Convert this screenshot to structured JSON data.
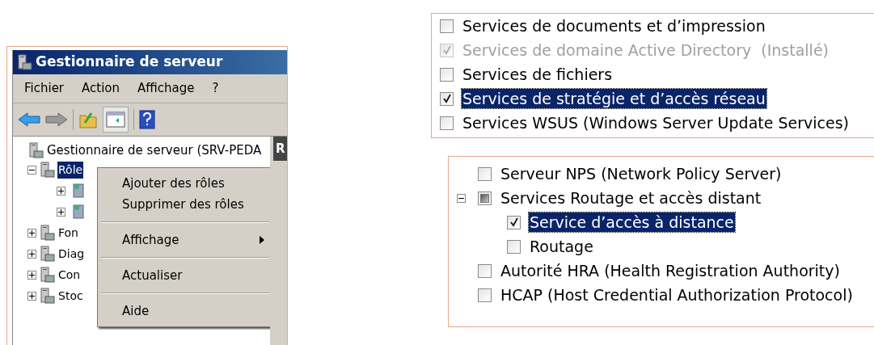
{
  "window": {
    "title": "Gestionnaire de serveur"
  },
  "menu_bar": [
    "Fichier",
    "Action",
    "Affichage",
    "?"
  ],
  "tree": {
    "label": "Gestionnaire de serveur (SRV-PEDA",
    "children": [
      {
        "label": "Rôle",
        "selected": true,
        "expanded": true,
        "children": [
          {
            "expanded": false
          },
          {
            "expanded": false
          }
        ]
      },
      {
        "label": "Fon",
        "selected": false,
        "expanded": false
      },
      {
        "label": "Diag",
        "selected": false,
        "expanded": false
      },
      {
        "label": "Con",
        "selected": false,
        "expanded": false
      },
      {
        "label": "Stoc",
        "selected": false,
        "expanded": false
      }
    ]
  },
  "right_pane_header": "R",
  "context_menu": [
    {
      "kind": "item",
      "label": "Ajouter des rôles"
    },
    {
      "kind": "item",
      "label": "Supprimer des rôles"
    },
    {
      "kind": "separator"
    },
    {
      "kind": "submenu",
      "label": "Affichage"
    },
    {
      "kind": "separator"
    },
    {
      "kind": "item",
      "label": "Actualiser"
    },
    {
      "kind": "separator"
    },
    {
      "kind": "item",
      "label": "Aide"
    }
  ],
  "roles_list": [
    {
      "label": "Services de documents et d’impression",
      "checked": false,
      "disabled": false,
      "selected": false
    },
    {
      "label": "Services de domaine Active Directory  (Installé)",
      "checked": true,
      "disabled": true,
      "selected": false
    },
    {
      "label": "Services de fichiers",
      "checked": false,
      "disabled": false,
      "selected": false
    },
    {
      "label": "Services de stratégie et d’accès réseau",
      "checked": true,
      "disabled": false,
      "selected": true
    },
    {
      "label": "Services WSUS (Windows Server Update Services)",
      "checked": false,
      "disabled": false,
      "selected": false
    }
  ],
  "role_services": [
    {
      "label": "Serveur NPS (Network Policy Server)",
      "checked": false,
      "selected": false
    },
    {
      "label": "Services Routage et accès distant",
      "checked": false,
      "partial": true,
      "selected": false,
      "expanded": true,
      "children": [
        {
          "label": "Service d’accès à distance",
          "checked": true,
          "selected": true
        },
        {
          "label": "Routage",
          "checked": false,
          "selected": false
        }
      ]
    },
    {
      "label": "Autorité HRA (Health Registration Authority)",
      "checked": false,
      "selected": false
    },
    {
      "label": "HCAP (Host Credential Authorization Protocol)",
      "checked": false,
      "selected": false
    }
  ]
}
